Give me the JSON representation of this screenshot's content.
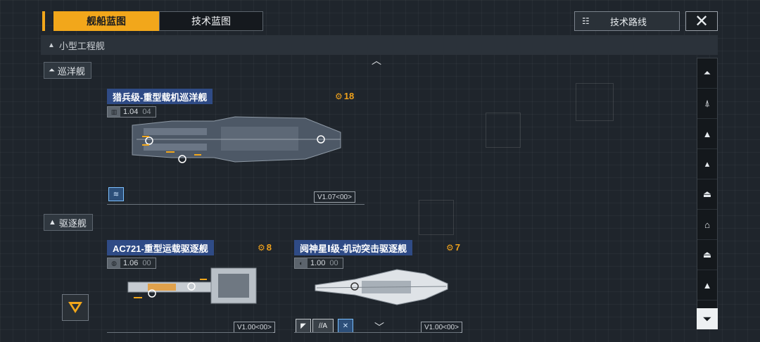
{
  "tabs": {
    "ship_blueprint": "舰船蓝图",
    "tech_blueprint": "技术蓝图",
    "tech_route": "技术路线",
    "close": "✕"
  },
  "section": {
    "title": "小型工程舰"
  },
  "categories": {
    "cruiser": "巡洋舰",
    "destroyer": "驱逐舰"
  },
  "ships": [
    {
      "name": "猎兵级-重型载机巡洋舰",
      "cost": "18",
      "version": "1.04",
      "version_sub": "04",
      "version_tag": "V1.07<00>"
    },
    {
      "name": "AC721-重型运载驱逐舰",
      "cost": "8",
      "version": "1.06",
      "version_sub": "00",
      "version_tag": "V1.00<00>"
    },
    {
      "name": "阋神星Ⅰ级-机动突击驱逐舰",
      "cost": "7",
      "version": "1.00",
      "version_sub": "00",
      "version_tag": "V1.00<00>",
      "feature_label": "//A"
    }
  ],
  "colors": {
    "accent": "#f2a71b",
    "name_bg": "#2f4b86",
    "background": "#1f252c"
  }
}
